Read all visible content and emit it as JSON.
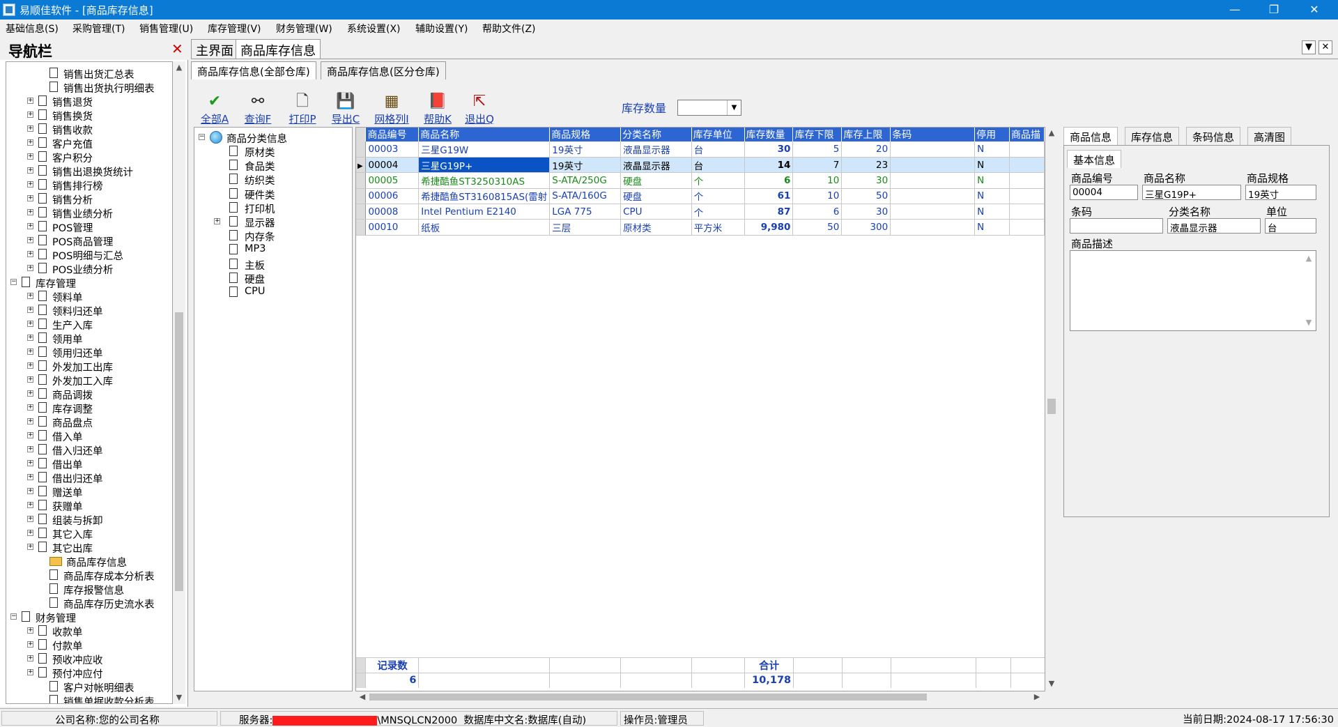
{
  "window": {
    "title": "易顺佳软件 - [商品库存信息]"
  },
  "menu": [
    "基础信息(S)",
    "采购管理(T)",
    "销售管理(U)",
    "库存管理(V)",
    "财务管理(W)",
    "系统设置(X)",
    "辅助设置(Y)",
    "帮助文件(Z)"
  ],
  "nav": {
    "title": "导航栏",
    "items": [
      {
        "label": "销售出货汇总表",
        "level": 2,
        "type": "doc"
      },
      {
        "label": "销售出货执行明细表",
        "level": 2,
        "type": "doc"
      },
      {
        "label": "销售退货",
        "level": 1,
        "type": "plus"
      },
      {
        "label": "销售换货",
        "level": 1,
        "type": "plus"
      },
      {
        "label": "销售收款",
        "level": 1,
        "type": "plus"
      },
      {
        "label": "客户充值",
        "level": 1,
        "type": "plus"
      },
      {
        "label": "客户积分",
        "level": 1,
        "type": "plus"
      },
      {
        "label": "销售出退换货统计",
        "level": 1,
        "type": "plus"
      },
      {
        "label": "销售排行榜",
        "level": 1,
        "type": "plus"
      },
      {
        "label": "销售分析",
        "level": 1,
        "type": "plus"
      },
      {
        "label": "销售业绩分析",
        "level": 1,
        "type": "plus"
      },
      {
        "label": "POS管理",
        "level": 1,
        "type": "plus"
      },
      {
        "label": "POS商品管理",
        "level": 1,
        "type": "plus"
      },
      {
        "label": "POS明细与汇总",
        "level": 1,
        "type": "plus"
      },
      {
        "label": "POS业绩分析",
        "level": 1,
        "type": "plus"
      },
      {
        "label": "库存管理",
        "level": 0,
        "type": "minus"
      },
      {
        "label": "领料单",
        "level": 1,
        "type": "plus"
      },
      {
        "label": "领料归还单",
        "level": 1,
        "type": "plus"
      },
      {
        "label": "生产入库",
        "level": 1,
        "type": "plus"
      },
      {
        "label": "领用单",
        "level": 1,
        "type": "plus"
      },
      {
        "label": "领用归还单",
        "level": 1,
        "type": "plus"
      },
      {
        "label": "外发加工出库",
        "level": 1,
        "type": "plus"
      },
      {
        "label": "外发加工入库",
        "level": 1,
        "type": "plus"
      },
      {
        "label": "商品调拨",
        "level": 1,
        "type": "plus"
      },
      {
        "label": "库存调整",
        "level": 1,
        "type": "plus"
      },
      {
        "label": "商品盘点",
        "level": 1,
        "type": "plus"
      },
      {
        "label": "借入单",
        "level": 1,
        "type": "plus"
      },
      {
        "label": "借入归还单",
        "level": 1,
        "type": "plus"
      },
      {
        "label": "借出单",
        "level": 1,
        "type": "plus"
      },
      {
        "label": "借出归还单",
        "level": 1,
        "type": "plus"
      },
      {
        "label": "赠送单",
        "level": 1,
        "type": "plus"
      },
      {
        "label": "获赠单",
        "level": 1,
        "type": "plus"
      },
      {
        "label": "组装与拆卸",
        "level": 1,
        "type": "plus"
      },
      {
        "label": "其它入库",
        "level": 1,
        "type": "plus"
      },
      {
        "label": "其它出库",
        "level": 1,
        "type": "plus"
      },
      {
        "label": "商品库存信息",
        "level": 2,
        "type": "folder"
      },
      {
        "label": "商品库存成本分析表",
        "level": 2,
        "type": "doc"
      },
      {
        "label": "库存报警信息",
        "level": 2,
        "type": "doc"
      },
      {
        "label": "商品库存历史流水表",
        "level": 2,
        "type": "doc"
      },
      {
        "label": "财务管理",
        "level": 0,
        "type": "minus"
      },
      {
        "label": "收款单",
        "level": 1,
        "type": "plus"
      },
      {
        "label": "付款单",
        "level": 1,
        "type": "plus"
      },
      {
        "label": "预收冲应收",
        "level": 1,
        "type": "plus"
      },
      {
        "label": "预付冲应付",
        "level": 1,
        "type": "plus"
      },
      {
        "label": "客户对帐明细表",
        "level": 2,
        "type": "doc"
      },
      {
        "label": "销售单据收款分析表",
        "level": 2,
        "type": "doc"
      }
    ]
  },
  "top_tabs": [
    "主界面",
    "商品库存信息"
  ],
  "sub_tabs": [
    "商品库存信息(全部仓库)",
    "商品库存信息(区分仓库)"
  ],
  "toolbar": [
    {
      "label": "全部A",
      "icon": "check-icon",
      "glyph": "✔",
      "color": "#1e9a1e"
    },
    {
      "label": "查询F",
      "icon": "binoculars-icon",
      "glyph": "⚯",
      "color": "#222222"
    },
    {
      "label": "打印P",
      "icon": "print-preview-icon",
      "glyph": "🗋",
      "color": "#333333"
    },
    {
      "label": "导出C",
      "icon": "save-icon",
      "glyph": "💾",
      "color": "#1f3d8a"
    },
    {
      "label": "网格列I",
      "icon": "grid-columns-icon",
      "glyph": "▦",
      "color": "#6b4b12"
    },
    {
      "label": "帮助K",
      "icon": "help-book-icon",
      "glyph": "📕",
      "color": "#b02a5a"
    },
    {
      "label": "退出Q",
      "icon": "exit-icon",
      "glyph": "⇱",
      "color": "#b01010"
    }
  ],
  "filter": {
    "label": "库存数量",
    "value": ""
  },
  "category_tree": {
    "root": "商品分类信息",
    "items": [
      {
        "label": "原材类",
        "expand": false
      },
      {
        "label": "食品类",
        "expand": false
      },
      {
        "label": "纺织类",
        "expand": false
      },
      {
        "label": "硬件类",
        "expand": false
      },
      {
        "label": "打印机",
        "expand": false
      },
      {
        "label": "显示器",
        "expand": true
      },
      {
        "label": "内存条",
        "expand": false
      },
      {
        "label": "MP3",
        "expand": false
      },
      {
        "label": "主板",
        "expand": false
      },
      {
        "label": "硬盘",
        "expand": false
      },
      {
        "label": "CPU",
        "expand": false
      }
    ]
  },
  "grid": {
    "columns": [
      "商品编号",
      "商品名称",
      "商品规格",
      "分类名称",
      "库存单位",
      "库存数量",
      "库存下限",
      "库存上限",
      "条码",
      "停用",
      "商品描"
    ],
    "rows": [
      {
        "cells": [
          "00003",
          "三星G19W",
          "19英寸",
          "液晶显示器",
          "台",
          "30",
          "5",
          "20",
          "",
          "N",
          ""
        ],
        "color": "#1a3fb0",
        "selected": false
      },
      {
        "cells": [
          "00004",
          "三星G19P+",
          "19英寸",
          "液晶显示器",
          "台",
          "14",
          "7",
          "23",
          "",
          "N",
          ""
        ],
        "color": "#000000",
        "selected": true
      },
      {
        "cells": [
          "00005",
          "希捷酷鱼ST3250310AS",
          "S-ATA/250G",
          "硬盘",
          "个",
          "6",
          "10",
          "30",
          "",
          "N",
          ""
        ],
        "color": "#1a8a1a",
        "selected": false
      },
      {
        "cells": [
          "00006",
          "希捷酷鱼ST3160815AS(雷射",
          "S-ATA/160G",
          "硬盘",
          "个",
          "61",
          "10",
          "50",
          "",
          "N",
          ""
        ],
        "color": "#1a3fb0",
        "selected": false
      },
      {
        "cells": [
          "00008",
          "Intel Pentium E2140",
          "LGA 775",
          "CPU",
          "个",
          "87",
          "6",
          "30",
          "",
          "N",
          ""
        ],
        "color": "#1a3fb0",
        "selected": false
      },
      {
        "cells": [
          "00010",
          "纸板",
          "三层",
          "原材类",
          "平方米",
          "9,980",
          "50",
          "300",
          "",
          "N",
          ""
        ],
        "color": "#1a3fb0",
        "selected": false
      }
    ],
    "footer": {
      "count_label": "记录数",
      "count": "6",
      "sum_label": "合计",
      "sum": "10,178"
    }
  },
  "detail": {
    "tabs": [
      "商品信息",
      "库存信息",
      "条码信息",
      "高清图"
    ],
    "section": "基本信息",
    "fields": {
      "code_label": "商品编号",
      "code": "00004",
      "name_label": "商品名称",
      "name": "三星G19P+",
      "spec_label": "商品规格",
      "spec": "19英寸",
      "barcode_label": "条码",
      "barcode": "",
      "category_label": "分类名称",
      "category": "液晶显示器",
      "unit_label": "单位",
      "unit": "台",
      "desc_label": "商品描述"
    }
  },
  "status": {
    "company": "公司名称:您的公司名称",
    "server_prefix": "服务器:",
    "server_suffix": "\\MNSQLCN2000",
    "database": "数据库中文名:数据库(自动)",
    "operator": "操作员:管理员",
    "date": "当前日期:2024-08-17 17:56:30"
  }
}
